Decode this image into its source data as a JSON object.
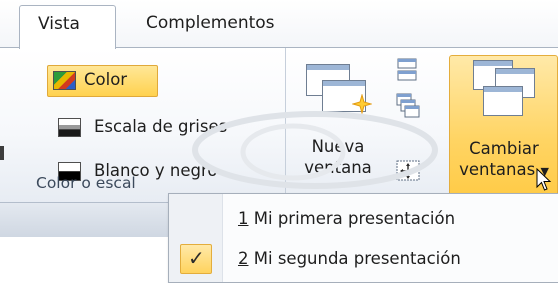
{
  "tabs": [
    {
      "label": "Vista",
      "active": true
    },
    {
      "label": "Complementos",
      "active": false
    }
  ],
  "color_group": {
    "options": [
      {
        "label": "Color",
        "selected": true,
        "icon": "color-swatch-icon"
      },
      {
        "label": "Escala de grises",
        "selected": false,
        "icon": "grayscale-swatch-icon"
      },
      {
        "label": "Blanco y negro",
        "selected": false,
        "icon": "black-white-swatch-icon"
      }
    ],
    "label": "Color o escal"
  },
  "window_group": {
    "new_window": {
      "line1": "Nueva",
      "line2": "ventana",
      "icon": "new-window-icon"
    },
    "switch_windows": {
      "line1": "Cambiar",
      "line2": "ventanas",
      "icon": "switch-windows-icon"
    },
    "small_icons": [
      "arrange-all-icon",
      "cascade-icon",
      "move-split-icon"
    ]
  },
  "menu": {
    "items": [
      {
        "accel": "1",
        "label": "Mi primera presentación",
        "checked": false
      },
      {
        "accel": "2",
        "label": "Mi segunda presentación",
        "checked": true
      }
    ],
    "check_icon": "checkmark-icon"
  },
  "colors": {
    "highlight": "#ffd24f",
    "ribbon_border": "#aab4c2",
    "group_label": "#3c4a5c"
  }
}
